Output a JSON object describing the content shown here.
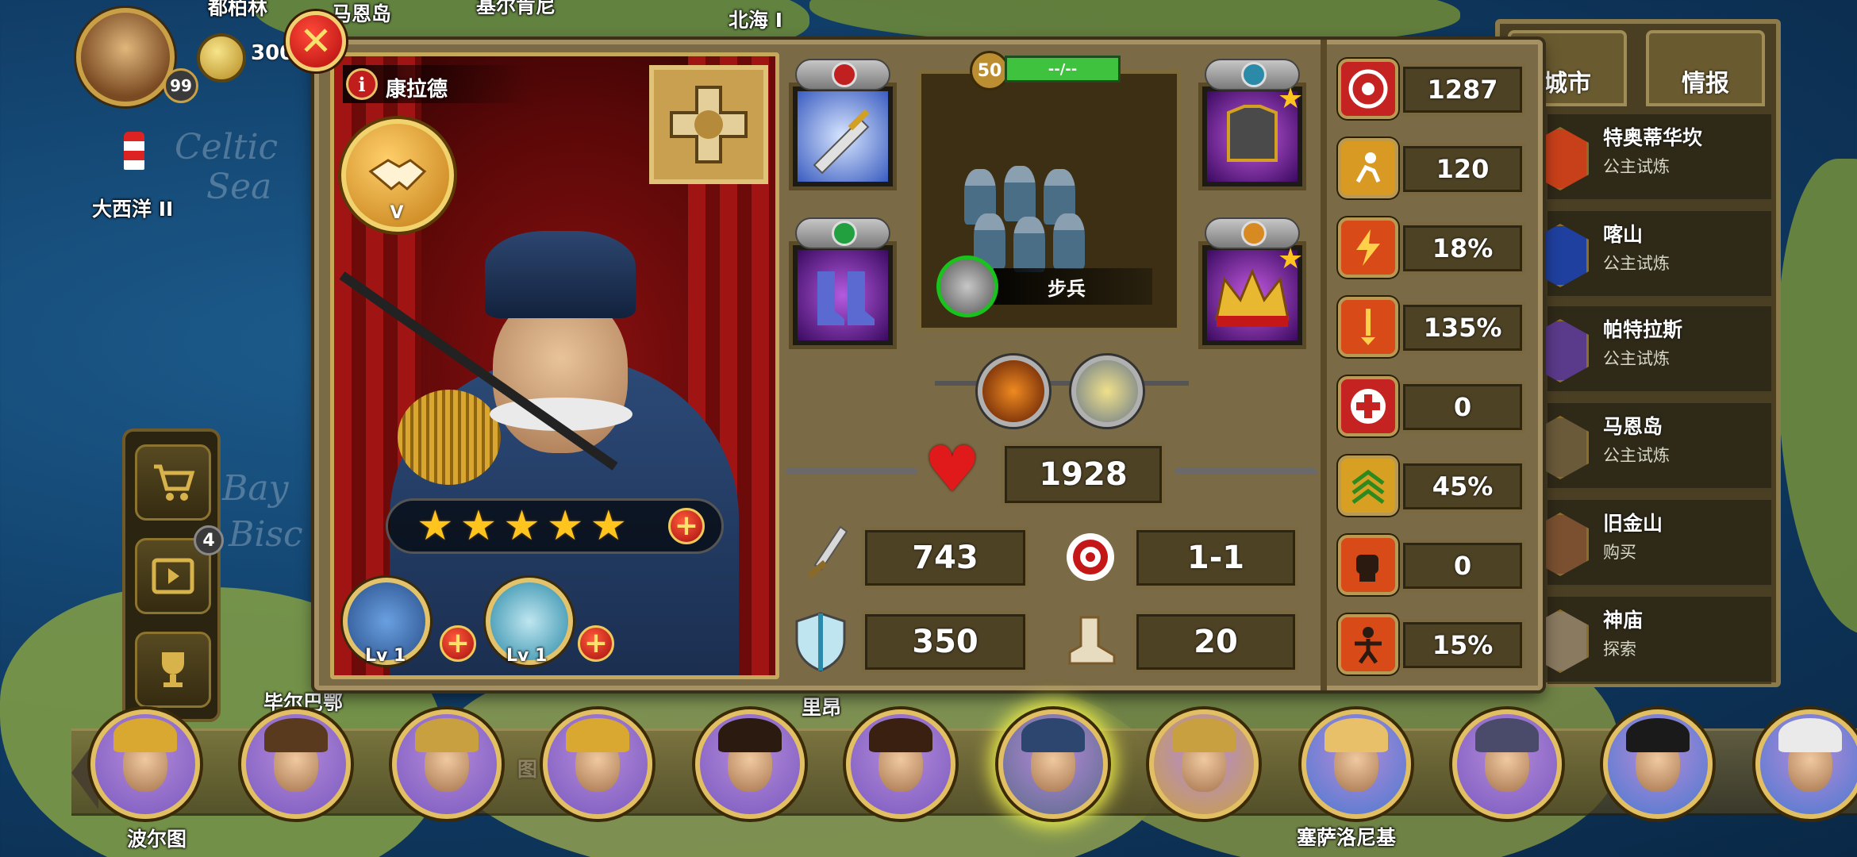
{
  "map": {
    "labels": {
      "top1": "都柏林",
      "top2": "马恩岛",
      "top3": "基尔肯尼",
      "top4": "北海 I",
      "atlantic": "大西洋 II",
      "celtic": "Celtic",
      "sea": "Sea",
      "bay": "Bay",
      "biscay": "Bisc",
      "bottom_left": "毕尔巴鄂",
      "bottom_mid": "图",
      "bottom_mid2": "里昂",
      "bordeaux": "波尔图",
      "thessaloniki": "塞萨洛尼基"
    }
  },
  "player": {
    "level": "99",
    "coins": "300"
  },
  "sidebar": {
    "video_badge": "4",
    "shop_icon": "cart-icon",
    "video_icon": "film-icon",
    "trophy_icon": "trophy-icon"
  },
  "hero": {
    "name": "康拉德",
    "rank": "V",
    "stars": 5,
    "skills": [
      {
        "label": "Lv 1",
        "icon": "infantry-skill-icon"
      },
      {
        "label": "Lv 1",
        "icon": "shield-skill-icon"
      }
    ]
  },
  "equipment": {
    "weapon": "sword-icon",
    "boots": "boots-icon",
    "armor": "armor-icon",
    "crown": "crown-icon"
  },
  "army": {
    "level": "50",
    "bar_text": "--/--",
    "unit_name": "步兵"
  },
  "stats": {
    "hp": "1928",
    "attack": "743",
    "range": "1-1",
    "defense": "350",
    "move": "20"
  },
  "right_stats": [
    {
      "icon": "target-icon",
      "value": "1287",
      "color": "#c52222"
    },
    {
      "icon": "rush-icon",
      "value": "120",
      "color": "#d89a22"
    },
    {
      "icon": "crit-icon",
      "value": "18%",
      "color": "#d84a18"
    },
    {
      "icon": "crit-damage-icon",
      "value": "135%",
      "color": "#d84a18"
    },
    {
      "icon": "heal-icon",
      "value": "0",
      "color": "#c52222"
    },
    {
      "icon": "rank-up-icon",
      "value": "45%",
      "color": "#d8a022"
    },
    {
      "icon": "fist-icon",
      "value": "0",
      "color": "#d84a18"
    },
    {
      "icon": "rage-icon",
      "value": "15%",
      "color": "#d84a18"
    }
  ],
  "city_panel": {
    "tabs": [
      "城市",
      "情报"
    ],
    "cities": [
      {
        "name": "特奥蒂华坎",
        "sub": "公主试炼"
      },
      {
        "name": "喀山",
        "sub": "公主试炼"
      },
      {
        "name": "帕特拉斯",
        "sub": "公主试炼"
      },
      {
        "name": "马恩岛",
        "sub": "公主试炼"
      },
      {
        "name": "旧金山",
        "sub": "购买"
      },
      {
        "name": "神庙",
        "sub": "探索"
      }
    ]
  },
  "hero_roster": [
    {
      "name": "queen-hero",
      "hat": "#d8a830"
    },
    {
      "name": "bearded-hero",
      "hat": "#5a3a1e"
    },
    {
      "name": "helmet-hero",
      "hat": "#c9a040"
    },
    {
      "name": "crowned-hero",
      "hat": "#d8a830"
    },
    {
      "name": "young-hero",
      "hat": "#2a1a10"
    },
    {
      "name": "longhair-hero",
      "hat": "#3a2010"
    },
    {
      "name": "conrad-hero",
      "hat": "#2d4670"
    },
    {
      "name": "ornate-hero",
      "hat": "#c9a040"
    },
    {
      "name": "lady-hero",
      "hat": "#e8c06a"
    },
    {
      "name": "wizard-hero",
      "hat": "#4a4a6a"
    },
    {
      "name": "napoleon-hero",
      "hat": "#1a1a1a"
    },
    {
      "name": "officer-hero",
      "hat": "#eaeaea"
    }
  ]
}
